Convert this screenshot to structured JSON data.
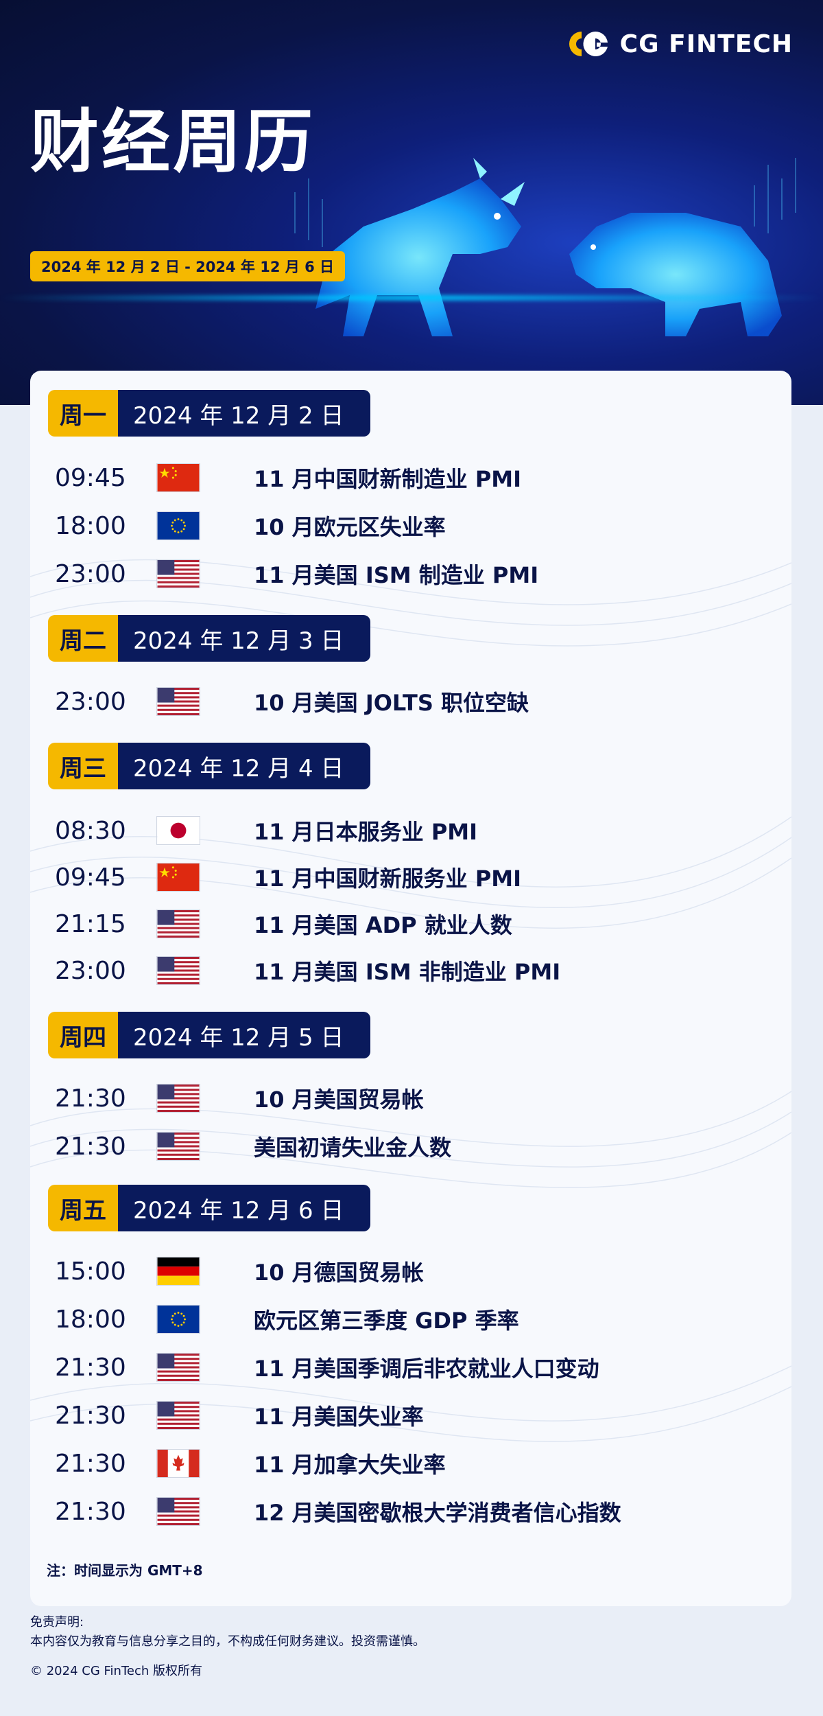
{
  "brand": {
    "name": "CG FINTECH"
  },
  "header": {
    "title": "财经周历",
    "date_range": "2024 年 12 月 2 日 - 2024 年 12 月 6 日"
  },
  "days": [
    {
      "tag": "周一",
      "date": "2024 年 12 月 2 日",
      "events": [
        {
          "time": "09:45",
          "flag": "cn",
          "name": "11 月中国财新制造业 PMI"
        },
        {
          "time": "18:00",
          "flag": "eu",
          "name": "10 月欧元区失业率"
        },
        {
          "time": "23:00",
          "flag": "us",
          "name": "11 月美国 ISM 制造业 PMI"
        }
      ]
    },
    {
      "tag": "周二",
      "date": "2024 年 12 月 3 日",
      "events": [
        {
          "time": "23:00",
          "flag": "us",
          "name": "10 月美国 JOLTS 职位空缺"
        }
      ]
    },
    {
      "tag": "周三",
      "date": "2024 年 12 月 4 日",
      "events": [
        {
          "time": "08:30",
          "flag": "jp",
          "name": "11 月日本服务业 PMI"
        },
        {
          "time": "09:45",
          "flag": "cn",
          "name": "11 月中国财新服务业 PMI"
        },
        {
          "time": "21:15",
          "flag": "us",
          "name": "11 月美国 ADP 就业人数"
        },
        {
          "time": "23:00",
          "flag": "us",
          "name": "11 月美国 ISM 非制造业 PMI"
        }
      ]
    },
    {
      "tag": "周四",
      "date": "2024 年 12 月 5 日",
      "events": [
        {
          "time": "21:30",
          "flag": "us",
          "name": "10 月美国贸易帐"
        },
        {
          "time": "21:30",
          "flag": "us",
          "name": "美国初请失业金人数"
        }
      ]
    },
    {
      "tag": "周五",
      "date": "2024 年 12 月 6 日",
      "events": [
        {
          "time": "15:00",
          "flag": "de",
          "name": "10 月德国贸易帐"
        },
        {
          "time": "18:00",
          "flag": "eu",
          "name": "欧元区第三季度 GDP 季率"
        },
        {
          "time": "21:30",
          "flag": "us",
          "name": "11 月美国季调后非农就业人口变动"
        },
        {
          "time": "21:30",
          "flag": "us",
          "name": "11 月美国失业率"
        },
        {
          "time": "21:30",
          "flag": "ca",
          "name": "11 月加拿大失业率"
        },
        {
          "time": "21:30",
          "flag": "us",
          "name": "12 月美国密歇根大学消费者信心指数"
        }
      ]
    }
  ],
  "note": "注：时间显示为 GMT+8",
  "footer": {
    "disclaimer_title": "免责声明:",
    "disclaimer_text": "本内容仅为教育与信息分享之目的，不构成任何财务建议。投资需谨慎。",
    "copyright": "© 2024 CG FinTech 版权所有"
  },
  "colors": {
    "navy": "#0a1a5c",
    "yellow": "#f5b800",
    "glow": "#1fc8ff"
  }
}
